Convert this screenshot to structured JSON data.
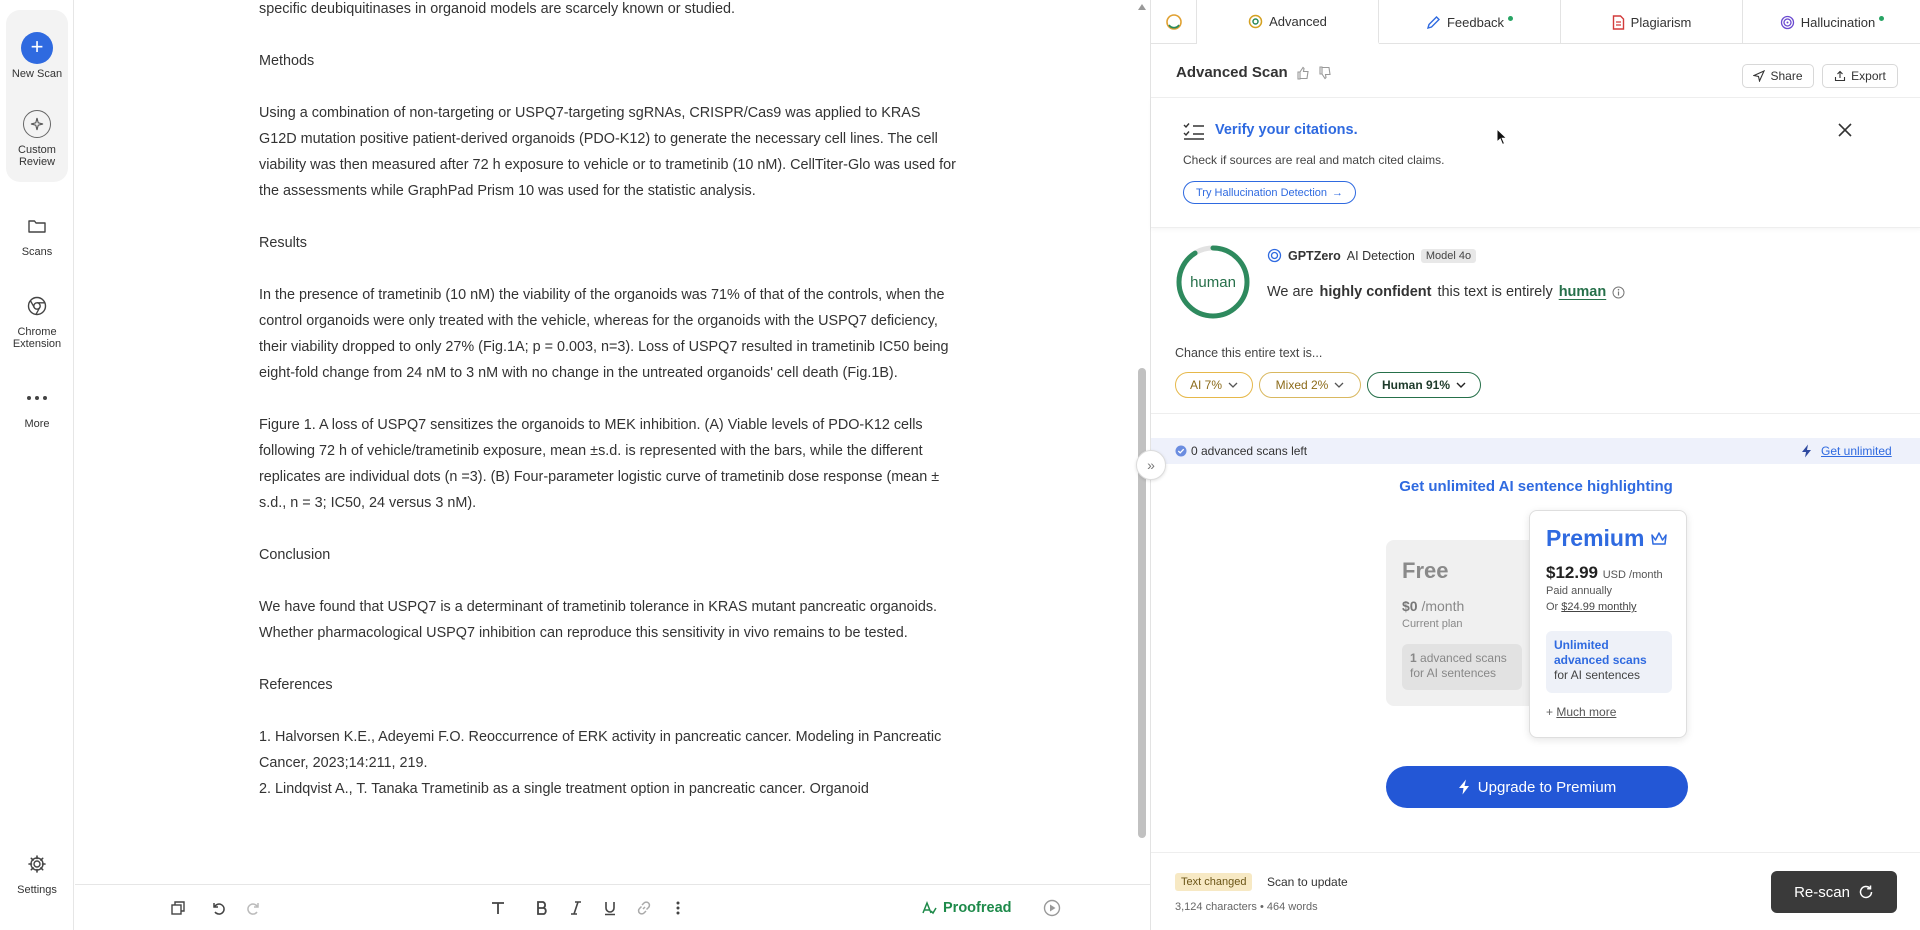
{
  "rail": {
    "new_scan": "New Scan",
    "custom_review_1": "Custom",
    "custom_review_2": "Review",
    "scans": "Scans",
    "chrome_1": "Chrome",
    "chrome_2": "Extension",
    "more": "More",
    "settings": "Settings"
  },
  "document": {
    "p0": "specific deubiquitinases in organoid models are scarcely known or studied.",
    "methods_h": "Methods",
    "methods": "Using a combination of non-targeting or USPQ7-targeting sgRNAs, CRISPR/Cas9 was applied to KRAS G12D mutation positive patient-derived organoids (PDO-K12) to generate the necessary cell lines. The cell viability was then measured after 72 h exposure to vehicle or to trametinib (10 nM). CellTiter-Glo was used for the assessments while GraphPad Prism 10 was used for the statistic analysis.",
    "results_h": "Results",
    "results": "In the presence of trametinib (10 nM) the viability of the organoids was 71% of that of the controls, when the control organoids were only treated with the vehicle, whereas for the organoids with the USPQ7 deficiency, their viability dropped to only 27% (Fig.1A; p = 0.003, n=3). Loss of USPQ7 resulted in trametinib IC50 being eight-fold change from 24 nM to 3 nM with no change in the untreated organoids' cell death (Fig.1B).",
    "figure": "Figure 1. A loss of USPQ7 sensitizes the organoids to MEK inhibition. (A) Viable levels of PDO-K12 cells following 72 h of vehicle/trametinib exposure, mean ±s.d. is represented with the bars, while the different replicates are individual dots (n =3). (B) Four-parameter logistic curve of trametinib dose response (mean ± s.d., n = 3; IC50, 24 versus 3 nM).",
    "conclusion_h": "Conclusion",
    "conclusion": "We have found that USPQ7 is a determinant of trametinib tolerance in KRAS mutant pancreatic organoids. Whether pharmacological USPQ7 inhibition can reproduce this sensitivity in vivo remains to be tested.",
    "references_h": "References",
    "ref1": "1. Halvorsen K.E., Adeyemi F.O. Reoccurrence of ERK activity in pancreatic cancer. Modeling in Pancreatic Cancer, 2023;14:211, 219.",
    "ref2": "2. Lindqvist A., T. Tanaka Trametinib as a single treatment option in pancreatic cancer. Organoid"
  },
  "toolbar": {
    "proofread": "Proofread"
  },
  "tabs": {
    "advanced": "Advanced",
    "feedback": "Feedback",
    "plagiarism": "Plagiarism",
    "hallucination": "Hallucination"
  },
  "scan": {
    "title": "Advanced Scan",
    "share": "Share",
    "export": "Export"
  },
  "verify": {
    "title": "Verify your citations.",
    "subtitle": "Check if sources are real and match cited claims.",
    "button": "Try Hallucination Detection"
  },
  "detection": {
    "ring_label": "human",
    "ring_fraction": 0.91,
    "brand": "GPTZero",
    "product": "AI Detection",
    "model": "Model 4o",
    "conf_pre": "We are",
    "conf_bold": "highly confident",
    "conf_mid": "this text is entirely",
    "conf_result": "human",
    "chance": "Chance this entire text is...",
    "ai": "AI 7%",
    "mixed": "Mixed 2%",
    "human": "Human 91%"
  },
  "scans_left": {
    "text": "0 advanced scans left",
    "link": "Get unlimited"
  },
  "upsell": {
    "title": "Get unlimited AI sentence highlighting",
    "free_name": "Free",
    "free_price": "$0",
    "free_per": "/month",
    "free_plan": "Current plan",
    "free_box_num": "1",
    "free_box_1": "advanced scans",
    "free_box_2": "for AI sentences",
    "prem_name": "Premium",
    "prem_price": "$12.99",
    "prem_per": "USD /month",
    "prem_annual": "Paid annually",
    "prem_or": "Or",
    "prem_monthly": "$24.99 monthly",
    "prem_box_1": "Unlimited",
    "prem_box_2": "advanced scans",
    "prem_box_3": "for AI sentences",
    "prem_more_plus": "+",
    "prem_more": "Much more",
    "upgrade": "Upgrade to Premium"
  },
  "footer": {
    "badge": "Text changed",
    "hint": "Scan to update",
    "counts": "3,124 characters • 464 words",
    "rescan": "Re-scan"
  },
  "colors": {
    "accent": "#2f6ae0",
    "human_green": "#26704a",
    "proofread_green": "#1e8a4a",
    "ai_yellow": "#e6b84a"
  }
}
